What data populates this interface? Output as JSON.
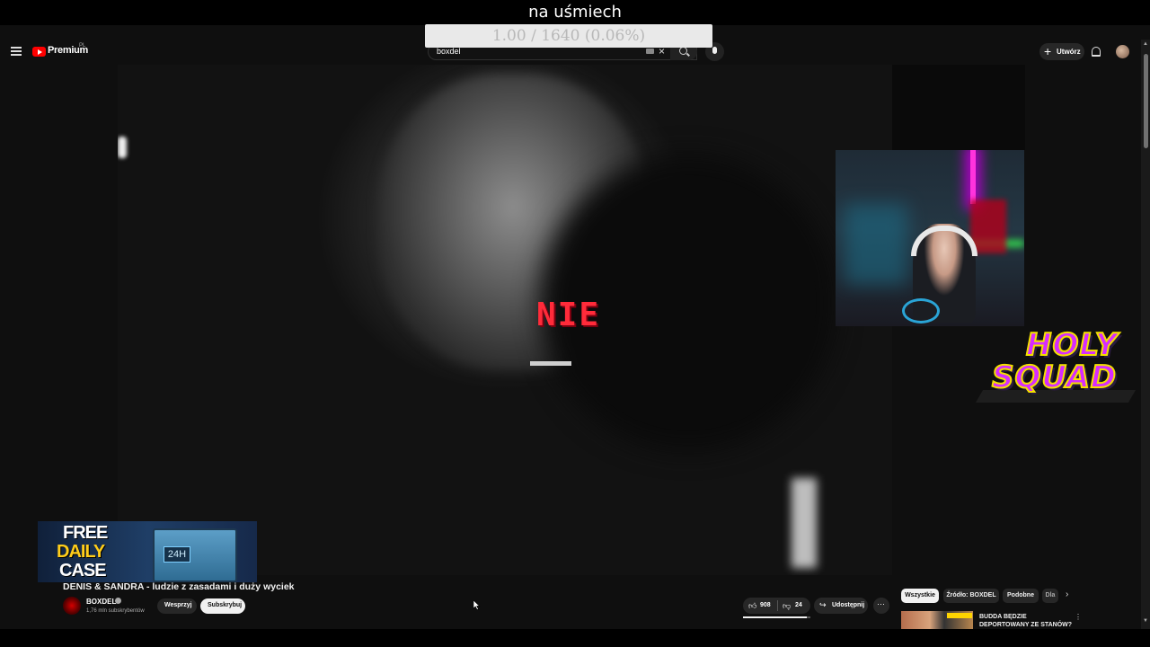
{
  "overlay": {
    "title": "na uśmiech",
    "progress_text": "1.00 / 1640 (0.06%)"
  },
  "header": {
    "logo_text": "Premium",
    "logo_region": "PL",
    "search_value": "boxdel",
    "create_label": "Utwórz",
    "icons": [
      "menu-icon",
      "youtube-logo-icon",
      "keyboard-icon",
      "clear-icon",
      "search-icon",
      "mic-icon",
      "plus-icon",
      "bell-icon",
      "avatar"
    ]
  },
  "player": {
    "subtitle": "NIE"
  },
  "overlays": {
    "logo_line1": "HOLY",
    "logo_line2": "SQUAD",
    "ad_line1": "FREE",
    "ad_line2": "DAILY",
    "ad_line3": "CASE",
    "ad_badge": "24H"
  },
  "video": {
    "title": "DENIS & SANDRA - ludzie z zasadami i duży wyciek",
    "channel_name": "BOXDEL",
    "channel_subs": "1,76 mln subskrybentów",
    "support_label": "Wesprzyj",
    "subscribe_label": "Subskrybuj",
    "like_count": "908",
    "dislike_count": "24",
    "like_ratio": 0.95,
    "share_label": "Udostępnij"
  },
  "chips": {
    "all": "Wszystkie",
    "source": "Źródło: BOXDEL",
    "similar": "Podobne",
    "more": "Dla"
  },
  "recommendation": {
    "title": "BUDDA BĘDZIE DEPORTOWANY ZE STANÓW? ELON MUSK w..."
  },
  "colors": {
    "accent_red": "#ff0000",
    "subtitle_red": "#ff2b3a",
    "logo_purple": "#d62cff",
    "logo_yellow": "#f4e000"
  }
}
